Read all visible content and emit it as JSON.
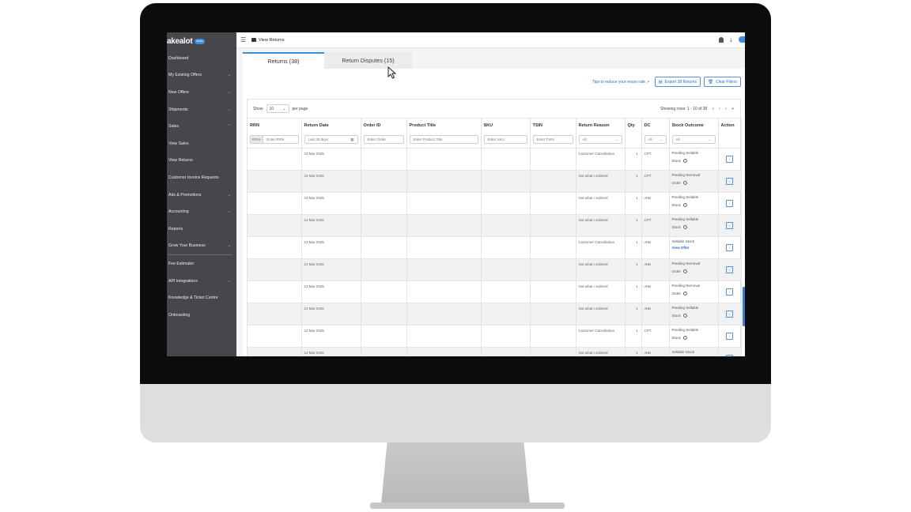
{
  "app": {
    "logo_text": "akealot",
    "logo_badge": "seller",
    "page_title": "View Returns"
  },
  "sidebar": {
    "items": [
      {
        "label": "Dashboard",
        "chevron": ""
      },
      {
        "label": "My Existing Offers",
        "chevron": "⌄"
      },
      {
        "label": "New Offers",
        "chevron": "⌄"
      },
      {
        "label": "Shipments",
        "chevron": "⌄"
      },
      {
        "label": "Sales",
        "chevron": "⌃"
      },
      {
        "label": "View Sales",
        "chevron": ""
      },
      {
        "label": "View Returns",
        "chevron": ""
      },
      {
        "label": "Customer Invoice Requests",
        "chevron": ""
      },
      {
        "label": "Ads & Promotions",
        "chevron": "⌄"
      },
      {
        "label": "Accounting",
        "chevron": "⌄"
      },
      {
        "label": "Reports",
        "chevron": ""
      },
      {
        "label": "Grow Your Business",
        "chevron": "⌄"
      },
      {
        "label": "Fee Estimator",
        "chevron": ""
      },
      {
        "label": "API Integrations",
        "chevron": "⌄"
      },
      {
        "label": "Knowledge & Ticket Centre",
        "chevron": ""
      },
      {
        "label": "Onboarding",
        "chevron": ""
      }
    ]
  },
  "tabs": {
    "returns": "Returns  (38)",
    "disputes": "Return Disputes  (15)"
  },
  "actions": {
    "tips": "Tips to reduce your return rate ↗",
    "export": "Export 38 Returns",
    "clear": "Clear Filters"
  },
  "controls": {
    "show": "Show",
    "per_page_value": "10",
    "per_page": "per page",
    "showing": "Showing rows: 1 - 10 of 38"
  },
  "columns": {
    "rrn": "RRN",
    "return_date": "Return Date",
    "order_id": "Order ID",
    "product_title": "Product Title",
    "sku": "SKU",
    "tsin": "TSIN",
    "return_reason": "Return Reason",
    "qty": "Qty",
    "dc": "DC",
    "stock_outcome": "Stock Outcome",
    "action": "Action"
  },
  "filters": {
    "rrn_prefix": "RRN-",
    "rrn": "Enter RRN",
    "date": "Last 30 days",
    "order": "Enter Order",
    "product": "Enter Product Title",
    "sku": "Enter SKU",
    "tsin": "Enter TSIN",
    "reason": "All",
    "dc": "All",
    "outcome": "All"
  },
  "rows": [
    {
      "date": "15 Mar 2025",
      "reason": "Customer Cancellation",
      "qty": "1",
      "dc": "CPT",
      "outcome1": "Pending Sellable",
      "outcome2": "Stock",
      "link": ""
    },
    {
      "date": "15 Mar 2025",
      "reason": "Not what I ordered",
      "qty": "1",
      "dc": "CPT",
      "outcome1": "Pending Removal",
      "outcome2": "Order",
      "link": ""
    },
    {
      "date": "15 Mar 2025",
      "reason": "Not what I ordered",
      "qty": "1",
      "dc": "JHB",
      "outcome1": "Pending Sellable",
      "outcome2": "Stock",
      "link": ""
    },
    {
      "date": "14 Mar 2025",
      "reason": "Not what I ordered",
      "qty": "1",
      "dc": "CPT",
      "outcome1": "Pending Sellable",
      "outcome2": "Stock",
      "link": ""
    },
    {
      "date": "13 Mar 2025",
      "reason": "Customer Cancellation",
      "qty": "1",
      "dc": "JHB",
      "outcome1": "Sellable Stock",
      "outcome2": "",
      "link": "View Offer"
    },
    {
      "date": "13 Mar 2025",
      "reason": "Not what I ordered",
      "qty": "1",
      "dc": "JHB",
      "outcome1": "Pending Removal",
      "outcome2": "Order",
      "link": ""
    },
    {
      "date": "13 Mar 2025",
      "reason": "Not what I ordered",
      "qty": "1",
      "dc": "JHB",
      "outcome1": "Pending Removal",
      "outcome2": "Order",
      "link": ""
    },
    {
      "date": "13 Mar 2025",
      "reason": "Not what I ordered",
      "qty": "1",
      "dc": "JHB",
      "outcome1": "Pending Sellable",
      "outcome2": "Stock",
      "link": ""
    },
    {
      "date": "12 Mar 2025",
      "reason": "Customer Cancellation",
      "qty": "1",
      "dc": "CPT",
      "outcome1": "Pending Sellable",
      "outcome2": "Stock",
      "link": ""
    },
    {
      "date": "12 Mar 2025",
      "reason": "Not what I ordered",
      "qty": "1",
      "dc": "JHB",
      "outcome1": "Sellable Stock",
      "outcome2": "",
      "link": ""
    }
  ],
  "colors": {
    "sidebar_bg": "#45474b",
    "accent": "#3a8fe0",
    "link": "#2a6fcf"
  }
}
